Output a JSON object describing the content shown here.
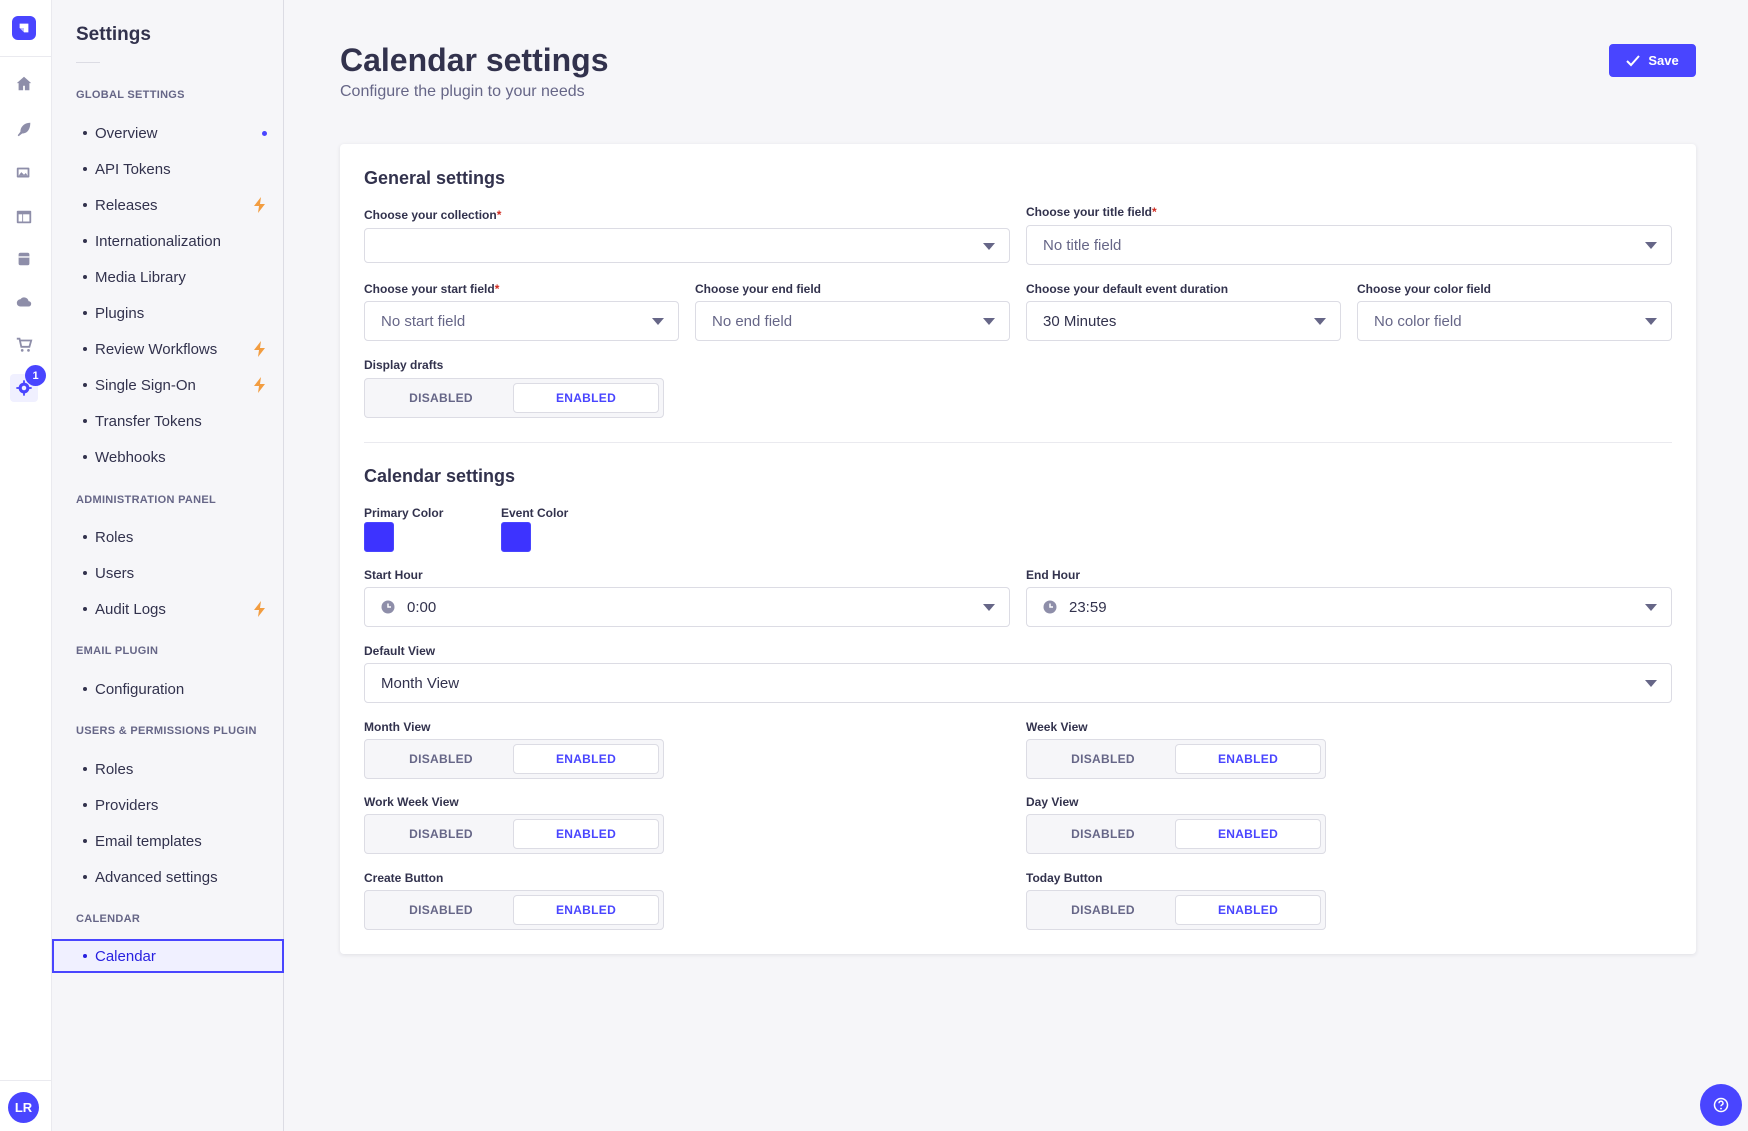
{
  "rail": {
    "badge_count": "1",
    "avatar_initials": "LR"
  },
  "sidebar": {
    "title": "Settings",
    "sections": [
      {
        "label": "Global Settings"
      },
      {
        "label": "Administration Panel"
      },
      {
        "label": "Email Plugin"
      },
      {
        "label": "Users & Permissions Plugin"
      },
      {
        "label": "Calendar"
      }
    ],
    "items": {
      "overview": "Overview",
      "api_tokens": "API Tokens",
      "releases": "Releases",
      "internationalization": "Internationalization",
      "media_library": "Media Library",
      "plugins": "Plugins",
      "review_workflows": "Review Workflows",
      "single_sign_on": "Single Sign-On",
      "transfer_tokens": "Transfer Tokens",
      "webhooks": "Webhooks",
      "admin_roles": "Roles",
      "users": "Users",
      "audit_logs": "Audit Logs",
      "configuration": "Configuration",
      "up_roles": "Roles",
      "providers": "Providers",
      "email_templates": "Email templates",
      "advanced_settings": "Advanced settings",
      "calendar": "Calendar"
    }
  },
  "header": {
    "title": "Calendar settings",
    "subtitle": "Configure the plugin to your needs",
    "save_label": "Save"
  },
  "general": {
    "heading": "General settings",
    "collection_label": "Choose your collection",
    "collection_value": "",
    "title_field_label": "Choose your title field",
    "title_field_value": "No title field",
    "start_field_label": "Choose your start field",
    "start_field_value": "No start field",
    "end_field_label": "Choose your end field",
    "end_field_value": "No end field",
    "duration_label": "Choose your default event duration",
    "duration_value": "30 Minutes",
    "color_field_label": "Choose your color field",
    "color_field_value": "No color field",
    "drafts_label": "Display drafts",
    "required_mark": "*"
  },
  "calendar": {
    "heading": "Calendar settings",
    "primary_color_label": "Primary Color",
    "primary_color": "#3d33ff",
    "event_color_label": "Event Color",
    "event_color": "#3d33ff",
    "start_hour_label": "Start Hour",
    "start_hour_value": "0:00",
    "end_hour_label": "End Hour",
    "end_hour_value": "23:59",
    "default_view_label": "Default View",
    "default_view_value": "Month View",
    "month_view_label": "Month View",
    "week_view_label": "Week View",
    "work_week_view_label": "Work Week View",
    "day_view_label": "Day View",
    "create_button_label": "Create Button",
    "today_button_label": "Today Button"
  },
  "toggle": {
    "disabled": "DISABLED",
    "enabled": "ENABLED"
  },
  "colors": {
    "accent": "#4945ff",
    "text": "#32324d",
    "muted": "#666687",
    "bolt": "#f29d41",
    "required": "#d02b20"
  }
}
